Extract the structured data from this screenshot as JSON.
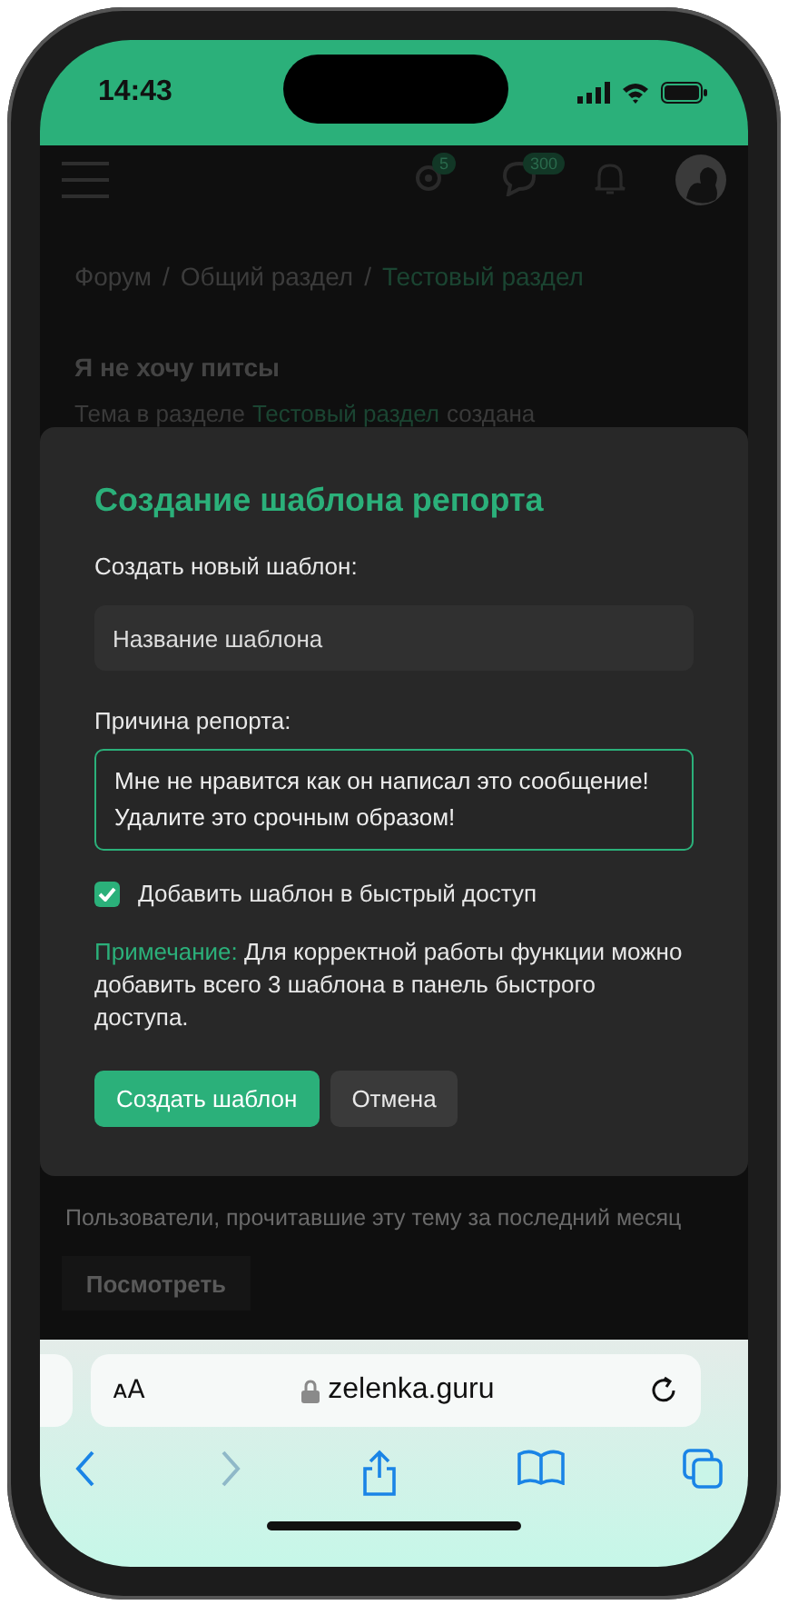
{
  "status_bar": {
    "time": "14:43"
  },
  "header": {
    "icons": [
      {
        "kind": "settings",
        "count": "5"
      },
      {
        "kind": "chat",
        "count": "300"
      },
      {
        "kind": "bell"
      }
    ]
  },
  "breadcrumbs": [
    {
      "label": "Форум",
      "current": false
    },
    {
      "separator": "/",
      "label": "Общий раздел",
      "current": false
    },
    {
      "separator": "/",
      "label": "Тестовый раздел",
      "current": true
    }
  ],
  "thread": {
    "title": "Я не хочу питсы",
    "meta_before": "Тема в разделе",
    "meta_link": "Тестовый раздел",
    "meta_after": "создана"
  },
  "modal": {
    "title": "Создание шаблона репорта",
    "new_label": "Создать новый шаблон:",
    "name_field": {
      "placeholder": "Название шаблона"
    },
    "reason_label": "Причина репорта:",
    "reason_field": {
      "value": "Мне не нравится как он написал это сообщение! Удалите это срочным образом!"
    },
    "quick_access": {
      "label": "Добавить шаблон в быстрый доступ",
      "checked": true
    },
    "note": {
      "label": "Примечание:",
      "text": "Для корректной работы функции можно добавить всего 3 шаблона в панель быстрого доступа."
    },
    "buttons": [
      {
        "label": "Создать шаблон",
        "kind": "primary"
      },
      {
        "label": "Отмена",
        "kind": "secondary"
      }
    ]
  },
  "readers": {
    "text": "Пользователи, прочитавшие эту тему за последний месяц",
    "button": "Посмотреть"
  },
  "browser": {
    "text_size": "ᴀA",
    "url": "zelenka.guru"
  }
}
